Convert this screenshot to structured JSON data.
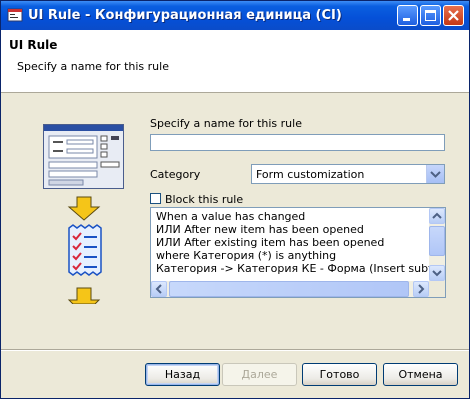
{
  "window": {
    "title": "UI Rule - Конфигурационная единица (CI)"
  },
  "header": {
    "title": "UI Rule",
    "subtitle": "Specify a name for this rule"
  },
  "form": {
    "name_label": "Specify a name for this rule",
    "name_value": "",
    "category_label": "Category",
    "category_value": "Form customization",
    "block_label": "Block this rule",
    "block_checked": false
  },
  "description_lines": [
    "When a value has changed",
    "ИЛИ After new item has been opened",
    "ИЛИ After existing item has been opened",
    "where Категория (*) is anything",
    "Категория -> Категория КЕ - Форма (Insert subform),"
  ],
  "buttons": {
    "back": "Назад",
    "next": "Далее",
    "finish": "Готово",
    "cancel": "Отмена"
  },
  "icons": [
    "app-icon",
    "minimize-icon",
    "maximize-icon",
    "close-icon",
    "form-illustration",
    "arrow-down-icon",
    "checklist-icon"
  ],
  "colors": {
    "titlebar": "#0550d8",
    "window_bg": "#ece9d8",
    "arrow": "#f5c518",
    "check": "#d8283c"
  }
}
